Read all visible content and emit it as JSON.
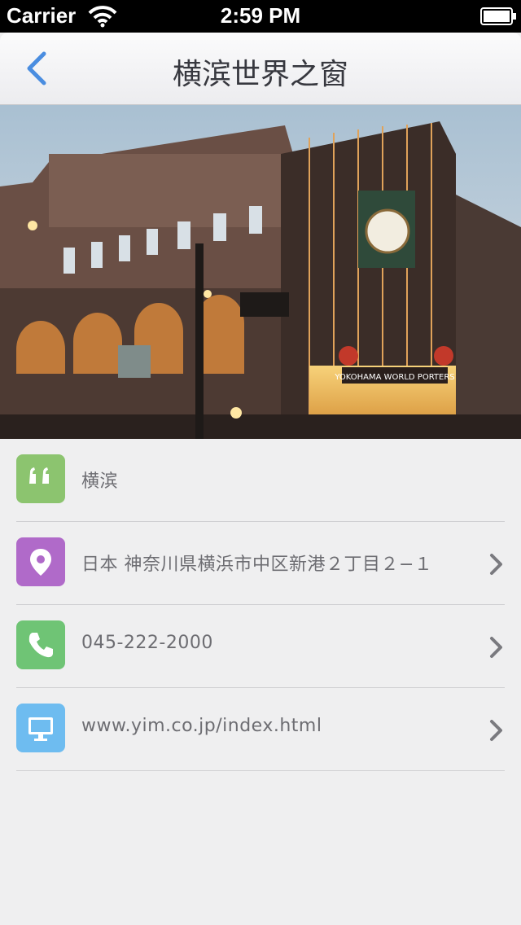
{
  "status_bar": {
    "carrier": "Carrier",
    "time": "2:59 PM"
  },
  "nav": {
    "title": "横滨世界之窗",
    "accent_color": "#4a8de0"
  },
  "hero": {
    "subject": "Yokohama World Porters building at dusk",
    "sign_text": "YOKOHAMA WORLD PORTERS"
  },
  "details": [
    {
      "icon": "quote-icon",
      "color": "#8cc46f",
      "text": "横滨",
      "has_chevron": false
    },
    {
      "icon": "map-pin-icon",
      "color": "#b06ac9",
      "text": "日本 神奈川県横浜市中区新港２丁目２−１",
      "has_chevron": true
    },
    {
      "icon": "phone-icon",
      "color": "#6fc475",
      "text": "045-222-2000",
      "has_chevron": true
    },
    {
      "icon": "monitor-icon",
      "color": "#6ebcf0",
      "text": "www.yim.co.jp/index.html",
      "has_chevron": true
    }
  ]
}
